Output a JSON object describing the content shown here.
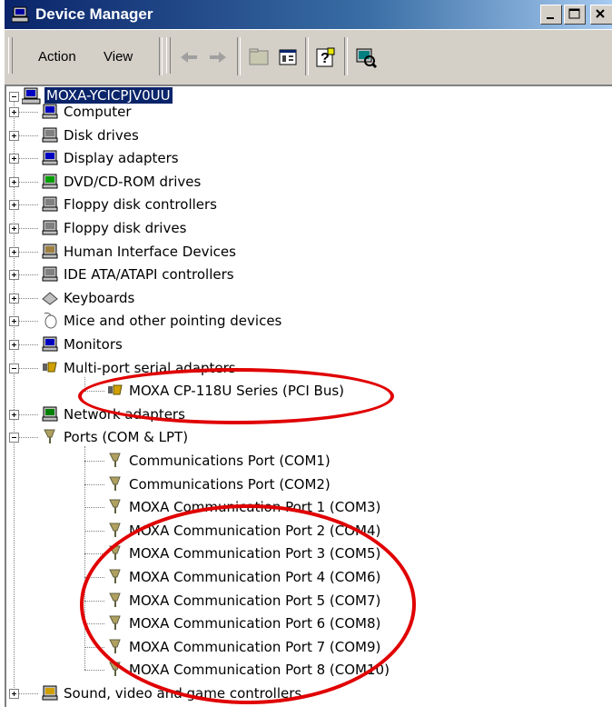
{
  "window": {
    "title": "Device Manager"
  },
  "menu": {
    "action": "Action",
    "view": "View"
  },
  "tree": {
    "root": "MOXA-YCICPJV0UU",
    "nodes": [
      {
        "label": "Computer",
        "icon": "computer-icon"
      },
      {
        "label": "Disk drives",
        "icon": "disk-drive-icon"
      },
      {
        "label": "Display adapters",
        "icon": "display-adapter-icon"
      },
      {
        "label": "DVD/CD-ROM drives",
        "icon": "dvd-drive-icon"
      },
      {
        "label": "Floppy disk controllers",
        "icon": "floppy-controller-icon"
      },
      {
        "label": "Floppy disk drives",
        "icon": "floppy-drive-icon"
      },
      {
        "label": "Human Interface Devices",
        "icon": "hid-icon"
      },
      {
        "label": "IDE ATA/ATAPI controllers",
        "icon": "ide-controller-icon"
      },
      {
        "label": "Keyboards",
        "icon": "keyboard-icon"
      },
      {
        "label": "Mice and other pointing devices",
        "icon": "mouse-icon"
      },
      {
        "label": "Monitors",
        "icon": "monitor-icon"
      },
      {
        "label": "Multi-port serial adapters",
        "icon": "multiport-adapter-icon"
      },
      {
        "label": "MOXA CP-118U Series (PCI Bus)",
        "icon": "multiport-adapter-icon"
      },
      {
        "label": "Network adapters",
        "icon": "network-adapter-icon"
      },
      {
        "label": "Ports (COM & LPT)",
        "icon": "port-icon"
      },
      {
        "label": "Communications Port (COM1)",
        "icon": "port-icon"
      },
      {
        "label": "Communications Port (COM2)",
        "icon": "port-icon"
      },
      {
        "label": "MOXA Communication Port 1 (COM3)",
        "icon": "port-icon"
      },
      {
        "label": "MOXA Communication Port 2 (COM4)",
        "icon": "port-icon"
      },
      {
        "label": "MOXA Communication Port 3 (COM5)",
        "icon": "port-icon"
      },
      {
        "label": "MOXA Communication Port 4 (COM6)",
        "icon": "port-icon"
      },
      {
        "label": "MOXA Communication Port 5 (COM7)",
        "icon": "port-icon"
      },
      {
        "label": "MOXA Communication Port 6 (COM8)",
        "icon": "port-icon"
      },
      {
        "label": "MOXA Communication Port 7 (COM9)",
        "icon": "port-icon"
      },
      {
        "label": "MOXA Communication Port 8 (COM10)",
        "icon": "port-icon"
      },
      {
        "label": "Sound, video and game controllers",
        "icon": "sound-icon"
      }
    ]
  },
  "colors": {
    "titlebar": "#0a246a",
    "selection": "#0a246a",
    "annotation": "#e00000"
  }
}
